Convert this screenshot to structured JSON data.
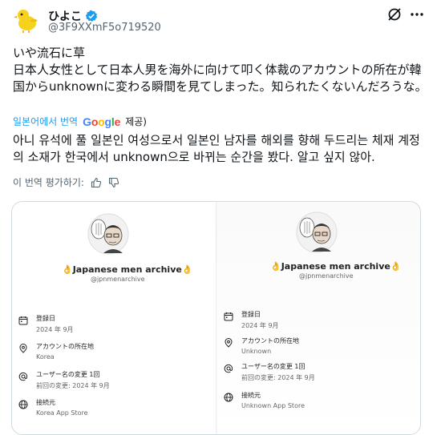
{
  "user": {
    "display_name": "ひよこ",
    "handle": "@3F9XXmF5o719520"
  },
  "tweet": {
    "text_ja": "いや流石に草\n日本人女性として日本人男を海外に向けて叩く体裁のアカウントの所在が韓国からunknownに変わる瞬間を見てしまった。知られたくないんだろうな。",
    "translated_by": "일본어에서 번역",
    "google_letters": [
      "G",
      "o",
      "o",
      "g",
      "l",
      "e"
    ],
    "provide_label": "제공)",
    "text_ko": "아니 유석에 풀 일본인 여성으로서 일본인 남자를 해외를 향해 두드리는 체재 계정의 소재가 한국에서 unknown으로 바뀌는 순간을 봤다. 알고 싶지 않아.",
    "rate_label": "이 번역 평가하기:"
  },
  "card": {
    "left": {
      "account_name": "Japanese men archive",
      "account_handle": "@jpnmenarchive",
      "rows": [
        {
          "icon": "calendar-icon",
          "title": "登録日",
          "value": "2024 年 9月"
        },
        {
          "icon": "location-icon",
          "title": "アカウントの所在地",
          "value": "Korea"
        },
        {
          "icon": "at-icon",
          "title": "ユーザー名の変更 1回",
          "value": "前回の変更: 2024 年 9月"
        },
        {
          "icon": "globe-icon",
          "title": "接続元",
          "value": "Korea App Store"
        }
      ]
    },
    "right": {
      "account_name": "Japanese men archive",
      "account_handle": "@jpnmenarchive",
      "rows": [
        {
          "icon": "calendar-icon",
          "title": "登録日",
          "value": "2024 年 9月"
        },
        {
          "icon": "location-icon",
          "title": "アカウントの所在地",
          "value": "Unknown"
        },
        {
          "icon": "at-icon",
          "title": "ユーザー名の変更 1回",
          "value": "前回の変更: 2024 年 9月"
        },
        {
          "icon": "globe-icon",
          "title": "接続元",
          "value": "Unknown App Store"
        }
      ]
    }
  },
  "colors": {
    "accent": "#1d9bf0",
    "text": "#0f1419",
    "secondary": "#536471"
  }
}
